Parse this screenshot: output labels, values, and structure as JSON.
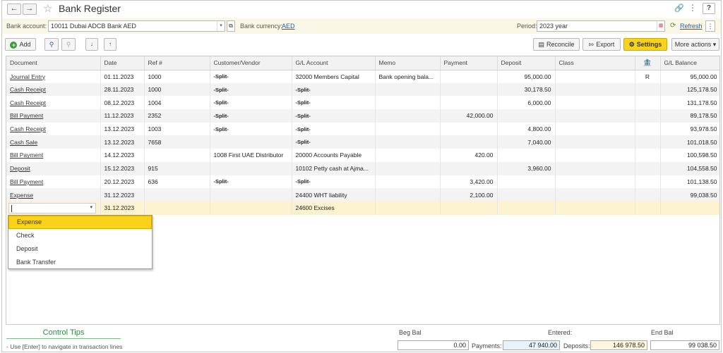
{
  "title": "Bank Register",
  "filters": {
    "bank_account_label": "Bank account:",
    "bank_account_value": "10011 Dubai ADCB Bank AED",
    "currency_label": "Bank currency:",
    "currency_value": "AED",
    "period_label": "Period:",
    "period_value": "2023 year",
    "refresh_label": "Refresh"
  },
  "toolbar": {
    "add_label": "Add",
    "reconcile_label": "Reconcile",
    "export_label": "Export",
    "settings_label": "Settings",
    "more_actions_label": "More actions"
  },
  "columns": [
    "Document",
    "Date",
    "Ref #",
    "Customer/Vendor",
    "G/L Account",
    "Memo",
    "Payment",
    "Deposit",
    "Class",
    "",
    "G/L Balance"
  ],
  "rows": [
    {
      "document": "Journal Entry",
      "date": "01.11.2023",
      "ref": "1000",
      "customer": "-Split-",
      "gl_account": "32000 Members Capital",
      "memo": "Bank opening bala...",
      "payment": "",
      "deposit": "95,000.00",
      "class": "",
      "reconciled": "R",
      "balance": "95,000.00"
    },
    {
      "document": "Cash Receipt",
      "date": "28.11.2023",
      "ref": "1000",
      "customer": "-Split-",
      "gl_account": "-Split-",
      "memo": "",
      "payment": "",
      "deposit": "30,178.50",
      "class": "",
      "reconciled": "",
      "balance": "125,178.50"
    },
    {
      "document": "Cash Receipt",
      "date": "08.12.2023",
      "ref": "1004",
      "customer": "-Split-",
      "gl_account": "-Split-",
      "memo": "",
      "payment": "",
      "deposit": "6,000.00",
      "class": "",
      "reconciled": "",
      "balance": "131,178.50"
    },
    {
      "document": "Bill Payment",
      "date": "11.12.2023",
      "ref": "2352",
      "customer": "-Split-",
      "gl_account": "-Split-",
      "memo": "",
      "payment": "42,000.00",
      "deposit": "",
      "class": "",
      "reconciled": "",
      "balance": "89,178.50"
    },
    {
      "document": "Cash Receipt",
      "date": "13.12.2023",
      "ref": "1003",
      "customer": "-Split-",
      "gl_account": "-Split-",
      "memo": "",
      "payment": "",
      "deposit": "4,800.00",
      "class": "",
      "reconciled": "",
      "balance": "93,978.50"
    },
    {
      "document": "Cash Sale",
      "date": "13.12.2023",
      "ref": "7658",
      "customer": "",
      "gl_account": "-Split-",
      "memo": "",
      "payment": "",
      "deposit": "7,040.00",
      "class": "",
      "reconciled": "",
      "balance": "101,018.50"
    },
    {
      "document": "Bill Payment",
      "date": "14.12.2023",
      "ref": "",
      "customer": "1008 First UAE Distributor",
      "gl_account": "20000 Accounts Payable",
      "memo": "",
      "payment": "420.00",
      "deposit": "",
      "class": "",
      "reconciled": "",
      "balance": "100,598.50"
    },
    {
      "document": "Deposit",
      "date": "15.12.2023",
      "ref": "915",
      "customer": "",
      "gl_account": "10102 Petty cash at Ajma...",
      "memo": "",
      "payment": "",
      "deposit": "3,960.00",
      "class": "",
      "reconciled": "",
      "balance": "104,558.50"
    },
    {
      "document": "Bill Payment",
      "date": "20.12.2023",
      "ref": "636",
      "customer": "-Split-",
      "gl_account": "-Split-",
      "memo": "",
      "payment": "3,420.00",
      "deposit": "",
      "class": "",
      "reconciled": "",
      "balance": "101,138.50"
    },
    {
      "document": "Expense",
      "date": "31.12.2023",
      "ref": "",
      "customer": "",
      "gl_account": "24400 WHT liability",
      "memo": "",
      "payment": "2,100.00",
      "deposit": "",
      "class": "",
      "reconciled": "",
      "balance": "99,038.50"
    }
  ],
  "new_row": {
    "document": "",
    "date": "31.12.2023",
    "gl_account": "24600 Excises"
  },
  "dropdown_options": [
    "Expense",
    "Check",
    "Deposit",
    "Bank Transfer"
  ],
  "footer": {
    "control_tips_title": "Control Tips",
    "tip_text": "- Use [Enter] to navigate in transaction lines",
    "beg_bal_label": "Beg Bal",
    "beg_bal_value": "0.00",
    "entered_label": "Entered:",
    "payments_label": "Payments:",
    "payments_value": "47 940.00",
    "deposits_label": "Deposits:",
    "deposits_value": "146 978.50",
    "end_bal_label": "End Bal",
    "end_bal_value": "99 038.50"
  },
  "colors": {
    "accent_yellow": "#f9d21b",
    "link_blue": "#1f5fae",
    "tips_green": "#2a8a3c",
    "payments_bg": "#e6f3fb",
    "deposits_bg": "#fdf6dc"
  },
  "icons": [
    "back-arrow-icon",
    "forward-arrow-icon",
    "star-icon",
    "link-icon",
    "kebab-menu-icon",
    "help-icon",
    "calendar-icon",
    "plus-icon",
    "find-icon",
    "cancel-find-icon",
    "sort-ascending-icon",
    "sort-descending-icon",
    "reconcile-icon",
    "export-icon",
    "settings-gear-icon",
    "bank-icon",
    "refresh-icon"
  ]
}
